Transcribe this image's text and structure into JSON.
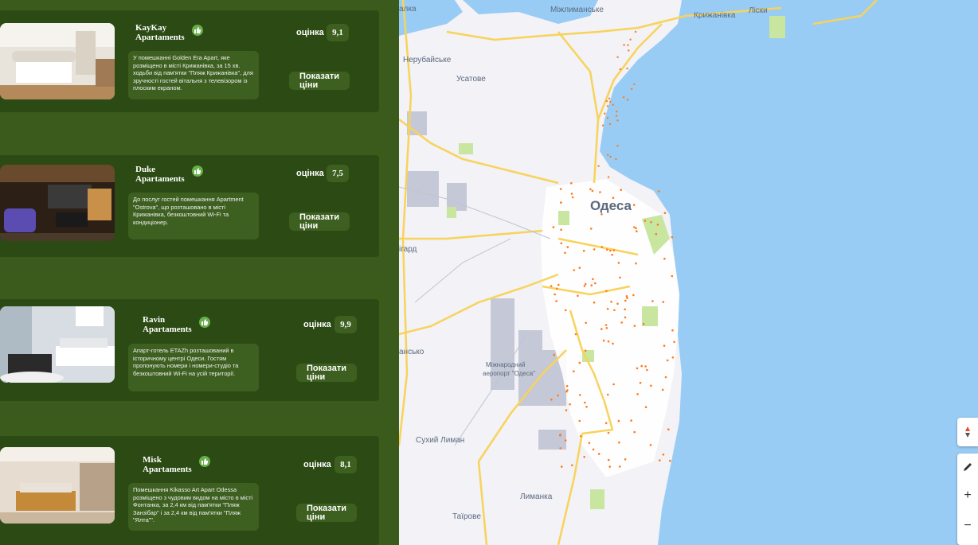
{
  "listings": [
    {
      "name_line1": "KayKay",
      "name_line2": "Apartaments",
      "rating_label": "оцінка",
      "rating": "9,1",
      "description": "У помешканні Golden Era Apart, яке розміщено в місті Крижанівка, за 15 хв. ходьби від пам'ятки \"Пляж Крижанівка\", для зручності гостей вітальня з телевізором із плоским екраном.",
      "button_label": "Показати ціни",
      "photo": "bright-bedroom-photo"
    },
    {
      "name_line1": "Duke",
      "name_line2": "Apartaments",
      "rating_label": "оцінка",
      "rating": "7,5",
      "description": "До послуг гостей помешкання Apartment \"Ostrova\", що розташовано в місті Крижанівка, безкоштовний Wi-Fi та кондиціонер.",
      "button_label": "Показати ціни",
      "photo": "dark-lounge-photo"
    },
    {
      "name_line1": "Ravin",
      "name_line2": "Apartaments",
      "rating_label": "оцінка",
      "rating": "9,9",
      "description": "Апарт-готель ETAZh розташований в історичному центрі Одеси. Гостям пропонують номери і номери-студіо та безкоштовний Wi-Fi на усій території.",
      "button_label": "Показати ціни",
      "photo": "white-bedroom-photo"
    },
    {
      "name_line1": "Misk",
      "name_line2": "Apartaments",
      "rating_label": "оцінка",
      "rating": "8,1",
      "description": "Помешкання Kikasso Art Apart Odessa розміщено з чудовим видом на місто в місті Фонтанка, за 2,4 км від пам'ятки \"Пляж Занзібар\" і за 2,4 км від пам'ятки \"Пляж \"Ялта\"\".",
      "button_label": "Показати ціни",
      "photo": "beige-bedroom-photo"
    }
  ],
  "map": {
    "city_label": "Одеса",
    "places": {
      "mizhlymanske": "Міжлиманське",
      "kryzhanivka": "Крижанівка",
      "lisky": "Ліски",
      "nerubaiske": "Нерубайське",
      "usatove": "Усатове",
      "airport_line1": "Міжнародний",
      "airport_line2": "аеропорт \"Одеса\"",
      "sukhyi_lyman": "Сухий Лиман",
      "lymanka": "Лиманка",
      "tairove": "Таїрове",
      "partial_top": "алка",
      "partial_west": "ігард",
      "partial_south": "ансько"
    },
    "colors": {
      "sea": "#99ccf5",
      "land": "#f2f2f7",
      "road": "#f8d35a",
      "park": "#c8e6a0",
      "industrial": "#c5c8d6",
      "marker": "#ff7a1a"
    }
  },
  "map_controls": {
    "compass_icon": "compass-icon",
    "edit_icon": "pencil-icon",
    "zoom_in": "+",
    "zoom_out": "−"
  }
}
